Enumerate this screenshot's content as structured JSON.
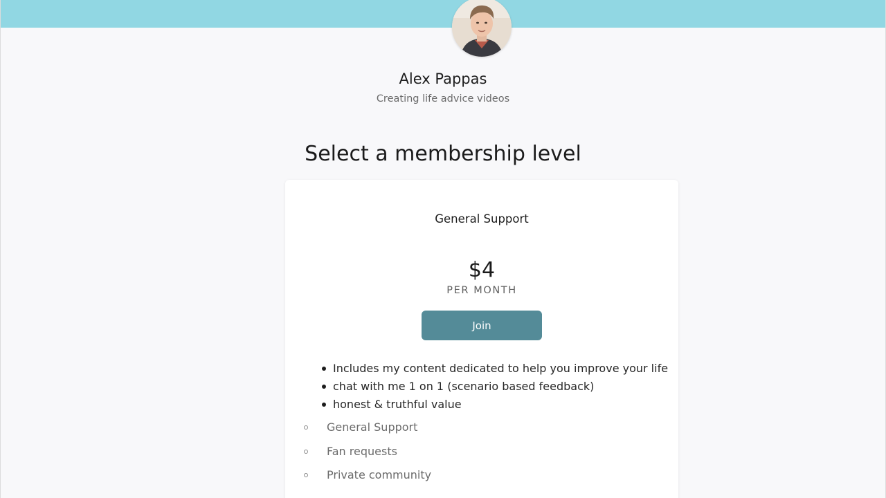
{
  "creator": {
    "name": "Alex Pappas",
    "tagline": "Creating life advice videos"
  },
  "heading": "Select a membership level",
  "tier": {
    "name": "General Support",
    "price": "$4",
    "period": "PER MONTH",
    "join_label": "Join",
    "benefits": [
      "Includes my content dedicated to help you improve your life",
      "chat with me 1 on 1 (scenario based feedback)",
      "honest & truthful value"
    ],
    "perks": [
      "General Support",
      "Fan requests",
      "Private community"
    ]
  },
  "colors": {
    "top_bar": "#91d7e3",
    "join_button": "#548b98",
    "background": "#f8f8fa"
  }
}
